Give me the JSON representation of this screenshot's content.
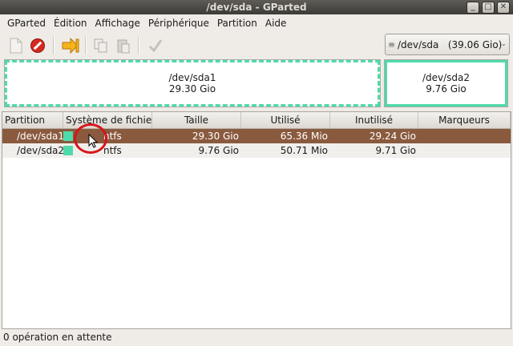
{
  "window": {
    "title": "/dev/sda - GParted",
    "buttons": [
      "_",
      "□",
      "✕"
    ]
  },
  "menu": [
    "GParted",
    "Édition",
    "Affichage",
    "Périphérique",
    "Partition",
    "Aide"
  ],
  "device_selector": {
    "label": "/dev/sda   (39.06 Gio)"
  },
  "visual": {
    "partitions": [
      {
        "name": "/dev/sda1",
        "size": "29.30 Gio"
      },
      {
        "name": "/dev/sda2",
        "size": "9.76 Gio"
      }
    ]
  },
  "table": {
    "headers": [
      "Partition",
      "Système de fichiers",
      "Taille",
      "Utilisé",
      "Inutilisé",
      "Marqueurs"
    ],
    "rows": [
      {
        "partition": "/dev/sda1",
        "fs": "ntfs",
        "size": "29.30 Gio",
        "used": "65.36 Mio",
        "unused": "29.24 Gio",
        "flags": ""
      },
      {
        "partition": "/dev/sda2",
        "fs": "ntfs",
        "size": "9.76 Gio",
        "used": "50.71 Mio",
        "unused": "9.71 Gio",
        "flags": ""
      }
    ]
  },
  "colors": {
    "ntfs": "#4fdba9",
    "selection": "#8a5a3e",
    "annotation": "#d6141a"
  },
  "status": "0 opération en attente"
}
